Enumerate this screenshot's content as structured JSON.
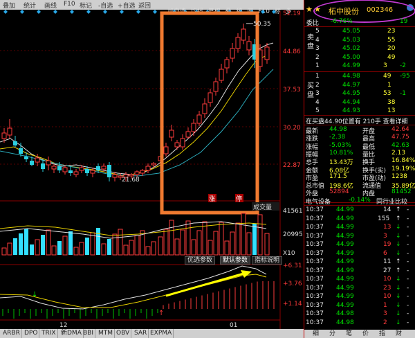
{
  "topbar": {
    "buttons": [
      "叠加",
      "统计",
      "画线",
      "F10",
      "标记",
      "-自选",
      "+自选",
      "返回"
    ]
  },
  "header_stats": [
    "加自选",
    "均线",
    "复权",
    "叠",
    "统",
    "画",
    "F10",
    "标",
    "多"
  ],
  "price_axis": [
    "52.19",
    "44.86",
    "37.53",
    "30.20",
    "22.87"
  ],
  "high_label": "50.35",
  "low_label": "21.68",
  "marker_zhang": "涨",
  "marker_ting": "停",
  "volume_label": "成交量",
  "volume_axis": [
    "41561",
    "20995",
    "X10"
  ],
  "sub_buttons": {
    "b1": "优选参数",
    "b2": "默认参数",
    "b3": "指标说明"
  },
  "macd_axis": [
    "+6.31",
    "+3.76",
    "+1.14"
  ],
  "date_labels": [
    "12",
    "01"
  ],
  "bottom_tabs": [
    "ARBR",
    "DPO",
    "TRIX",
    "新DMA",
    "BBI",
    "MTM",
    "OBV",
    "SAR",
    "EXPMA"
  ],
  "chart_data": {
    "type": "candlestick",
    "x_ticks": [
      "12",
      "01"
    ],
    "ylim": [
      21.68,
      52.19
    ],
    "y_ticks": [
      52.19,
      44.86,
      37.53,
      30.2,
      22.87
    ],
    "volume_ticks": [
      41561,
      20995
    ],
    "volume_unit": "X10",
    "indicator_ticks": [
      6.31,
      3.76,
      1.14
    ]
  },
  "panel": {
    "name": "柘中股份",
    "code": "002346",
    "weibi_label": "委比",
    "weibi_value": "-6.76%",
    "weibi_num": "19",
    "sell_label": "卖盘",
    "buy_label": "买盘",
    "sells": [
      {
        "lvl": "5",
        "price": "45.05",
        "vol": "23"
      },
      {
        "lvl": "4",
        "price": "45.03",
        "vol": "55"
      },
      {
        "lvl": "3",
        "price": "45.02",
        "vol": "20"
      },
      {
        "lvl": "2",
        "price": "45.00",
        "vol": "49"
      },
      {
        "lvl": "1",
        "price": "44.99",
        "vol": "3",
        "chg": "-2"
      }
    ],
    "buys": [
      {
        "lvl": "1",
        "price": "44.98",
        "vol": "49",
        "chg": "-95"
      },
      {
        "lvl": "2",
        "price": "44.97",
        "vol": "1"
      },
      {
        "lvl": "3",
        "price": "44.95",
        "vol": "53",
        "chg": "-1"
      },
      {
        "lvl": "4",
        "price": "44.94",
        "vol": "38"
      },
      {
        "lvl": "5",
        "price": "44.93",
        "vol": "13"
      }
    ],
    "notice": "在买盘44.90位置有 210手 查看详细",
    "stats": [
      {
        "l1": "最新",
        "v1": "44.98",
        "l2": "开盘",
        "v2": "42.64"
      },
      {
        "l1": "涨跌",
        "v1": "-2.38",
        "l2": "最高",
        "v2": "47.75"
      },
      {
        "l1": "涨幅",
        "v1": "-5.03%",
        "l2": "最低",
        "v2": "42.63"
      },
      {
        "l1": "振幅",
        "v1": "10.81%",
        "l2": "量比",
        "v2": "2.13"
      },
      {
        "l1": "总手",
        "v1": "13.43万",
        "l2": "换手",
        "v2": "16.84%"
      },
      {
        "l1": "金额",
        "v1": "6.08亿",
        "l2": "换手(实)",
        "v2": "19.19%"
      },
      {
        "l1": "市盈",
        "v1": "171.5",
        "l2": "市盈(动)",
        "v2": "1238"
      },
      {
        "l1": "总市值",
        "v1": "198.6亿",
        "l2": "流通值",
        "v2": "35.89亿"
      },
      {
        "l1": "外盘",
        "v1": "52894",
        "l2": "内盘",
        "v2": "81452"
      }
    ],
    "sector": "电气设备",
    "sector_change": "-0.14%",
    "sector_link": "同行业比较",
    "trades": [
      {
        "t": "10:37",
        "p": "44.99",
        "v": "14",
        "d": "up"
      },
      {
        "t": "10:37",
        "p": "44.99",
        "v": "155",
        "d": "up"
      },
      {
        "t": "10:37",
        "p": "44.99",
        "v": "13",
        "d": "down"
      },
      {
        "t": "10:37",
        "p": "44.99",
        "v": "3",
        "d": "down"
      },
      {
        "t": "10:37",
        "p": "44.99",
        "v": "19",
        "d": "down"
      },
      {
        "t": "10:37",
        "p": "44.99",
        "v": "6",
        "d": "down"
      },
      {
        "t": "10:37",
        "p": "44.99",
        "v": "11",
        "d": "up"
      },
      {
        "t": "10:37",
        "p": "44.99",
        "v": "27",
        "d": "up"
      },
      {
        "t": "10:37",
        "p": "44.99",
        "v": "10",
        "d": "down"
      },
      {
        "t": "10:37",
        "p": "44.99",
        "v": "23",
        "d": "down"
      },
      {
        "t": "10:37",
        "p": "44.99",
        "v": "10",
        "d": "down"
      },
      {
        "t": "10:37",
        "p": "44.99",
        "v": "1",
        "d": "down"
      },
      {
        "t": "10:37",
        "p": "44.98",
        "v": "3",
        "d": "down"
      },
      {
        "t": "10:37",
        "p": "44.98",
        "v": "2",
        "d": "down"
      }
    ],
    "tabs": [
      "细",
      "分",
      "笔",
      "价",
      "指",
      "财"
    ]
  }
}
